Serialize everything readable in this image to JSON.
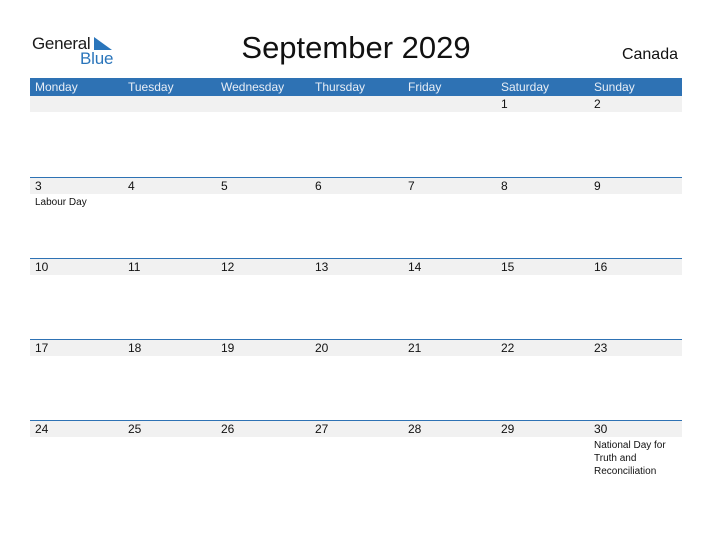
{
  "logo": {
    "word1": "General",
    "word2": "Blue"
  },
  "title": "September 2029",
  "country": "Canada",
  "colors": {
    "header_bg": "#2e72b4",
    "day_number_bg": "#f1f1f1",
    "accent": "#2a75bb"
  },
  "weekdays": [
    "Monday",
    "Tuesday",
    "Wednesday",
    "Thursday",
    "Friday",
    "Saturday",
    "Sunday"
  ],
  "weeks": [
    {
      "days": [
        "",
        "",
        "",
        "",
        "",
        "1",
        "2"
      ],
      "events": [
        "",
        "",
        "",
        "",
        "",
        "",
        ""
      ]
    },
    {
      "days": [
        "3",
        "4",
        "5",
        "6",
        "7",
        "8",
        "9"
      ],
      "events": [
        "Labour Day",
        "",
        "",
        "",
        "",
        "",
        ""
      ]
    },
    {
      "days": [
        "10",
        "11",
        "12",
        "13",
        "14",
        "15",
        "16"
      ],
      "events": [
        "",
        "",
        "",
        "",
        "",
        "",
        ""
      ]
    },
    {
      "days": [
        "17",
        "18",
        "19",
        "20",
        "21",
        "22",
        "23"
      ],
      "events": [
        "",
        "",
        "",
        "",
        "",
        "",
        ""
      ]
    },
    {
      "days": [
        "24",
        "25",
        "26",
        "27",
        "28",
        "29",
        "30"
      ],
      "events": [
        "",
        "",
        "",
        "",
        "",
        "",
        "National Day for Truth and Reconciliation"
      ]
    }
  ]
}
